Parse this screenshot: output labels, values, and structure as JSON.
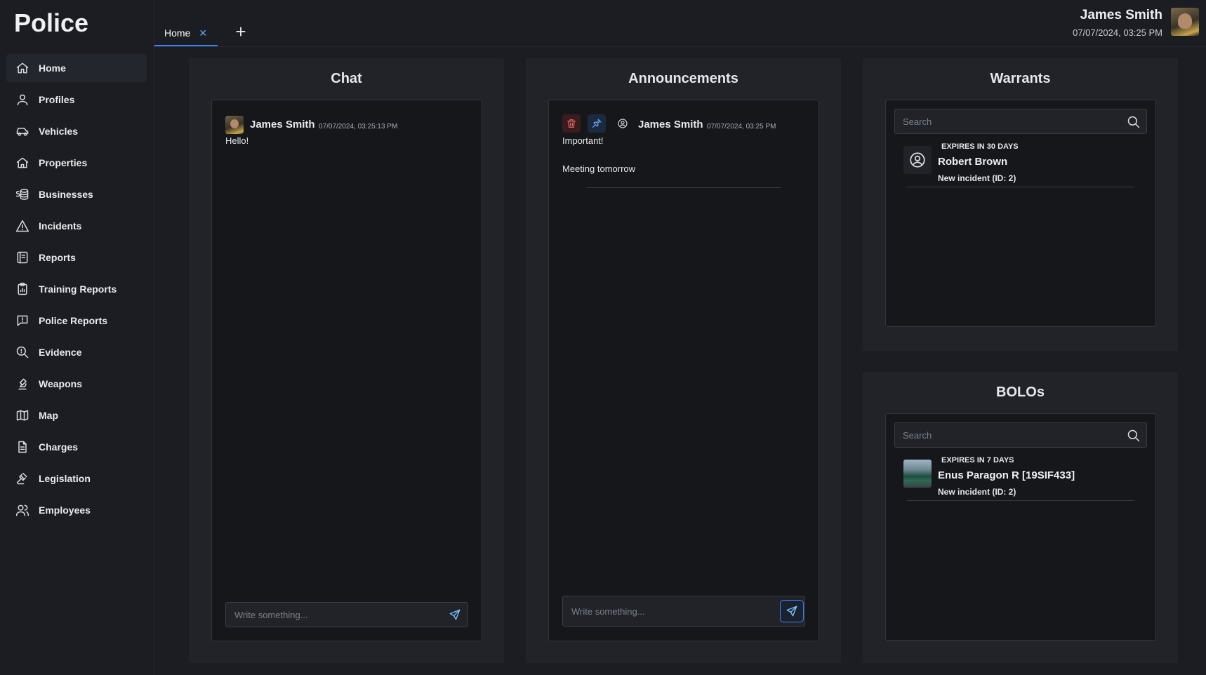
{
  "app": {
    "title": "Police"
  },
  "sidebar": {
    "items": [
      {
        "label": "Home",
        "icon": "home-icon",
        "active": true
      },
      {
        "label": "Profiles",
        "icon": "user-icon"
      },
      {
        "label": "Vehicles",
        "icon": "car-icon"
      },
      {
        "label": "Properties",
        "icon": "house-icon"
      },
      {
        "label": "Businesses",
        "icon": "money-icon"
      },
      {
        "label": "Incidents",
        "icon": "warning-icon"
      },
      {
        "label": "Reports",
        "icon": "report-icon"
      },
      {
        "label": "Training Reports",
        "icon": "clipboard-icon"
      },
      {
        "label": "Police Reports",
        "icon": "alert-message-icon"
      },
      {
        "label": "Evidence",
        "icon": "magnifier-icon"
      },
      {
        "label": "Weapons",
        "icon": "microscope-icon"
      },
      {
        "label": "Map",
        "icon": "map-icon"
      },
      {
        "label": "Charges",
        "icon": "document-icon"
      },
      {
        "label": "Legislation",
        "icon": "gavel-icon"
      },
      {
        "label": "Employees",
        "icon": "users-icon"
      }
    ]
  },
  "tabs": {
    "home_label": "Home",
    "close_glyph": "✕",
    "add_glyph": "+"
  },
  "user": {
    "name": "James Smith",
    "datetime": "07/07/2024, 03:25 PM"
  },
  "chat": {
    "title": "Chat",
    "message": {
      "author": "James Smith",
      "time": "07/07/2024, 03:25:13 PM",
      "text": "Hello!"
    },
    "compose_placeholder": "Write something..."
  },
  "announcements": {
    "title": "Announcements",
    "item": {
      "author": "James Smith",
      "time": "07/07/2024, 03:25 PM",
      "heading": "Important!",
      "body": "Meeting tomorrow"
    },
    "compose_placeholder": "Write something..."
  },
  "warrants": {
    "title": "Warrants",
    "search_placeholder": "Search",
    "entry": {
      "expiry": "EXPIRES IN 30 DAYS",
      "name": "Robert Brown",
      "subtitle": "New incident (ID: 2)"
    }
  },
  "bolos": {
    "title": "BOLOs",
    "search_placeholder": "Search",
    "entry": {
      "expiry": "EXPIRES IN 7 DAYS",
      "name": "Enus Paragon R [19SIF433]",
      "subtitle": "New incident (ID: 2)"
    }
  },
  "colors": {
    "background": "#1b1d22",
    "panel": "#212328",
    "inner": "#15171b",
    "accent": "#3b82f6",
    "danger": "#ef6b6b"
  }
}
